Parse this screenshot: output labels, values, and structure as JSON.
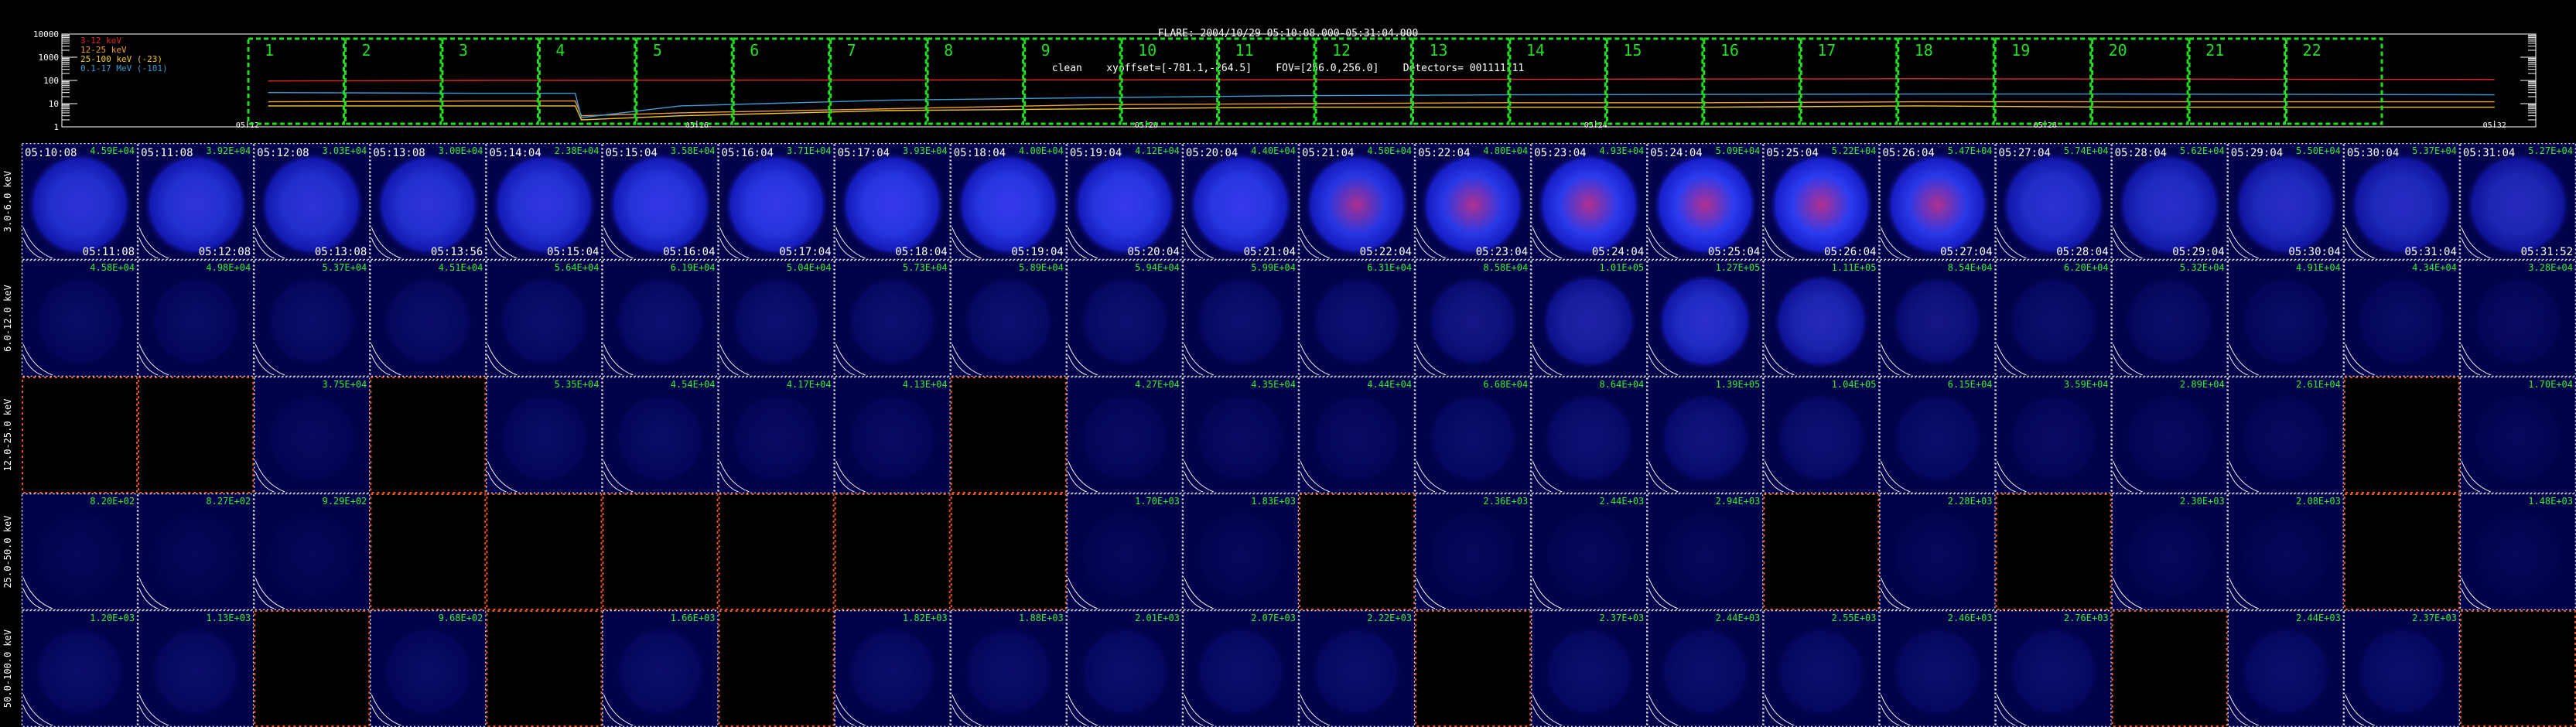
{
  "title": {
    "line1": "FLARE: 2004/10/29 05:10:08.000-05:31:04.000",
    "line2": "clean    xyoffset=[-781.1,-264.5]    FOV=[256.0,256.0]    Detectors= 001111111"
  },
  "colors": {
    "background": "#000000",
    "band_3_12": "#e0282a",
    "band_12_25": "#f0a030",
    "band_25_100": "#f5c820",
    "band_gamma": "#3c9bd6",
    "interval_box": "#22dd22",
    "empty_border": "#ee5522",
    "cell_border": "#e8e8e8",
    "text_green": "#33ee33",
    "disk": "#2a3cf0"
  },
  "chart_data": [
    {
      "type": "line",
      "name_hint": "lightcurve",
      "yscale": "log",
      "yticks": [
        "10000",
        "1000",
        "100",
        "10",
        "1"
      ],
      "ylim": [
        1,
        10000
      ],
      "xlim": [
        0,
        120
      ],
      "x_tick_labels": [
        "05:12",
        "05:16",
        "05:20",
        "05:24",
        "05:28",
        "05:32"
      ],
      "legend": {
        "placement": "top-left",
        "entries": [
          "3-12 keV",
          "12-25 keV",
          "25-100 keV (-23)",
          "0.1-17 MeV (-101)"
        ]
      },
      "intervals": [
        "1",
        "2",
        "3",
        "4",
        "5",
        "6",
        "7",
        "8",
        "9",
        "10",
        "11",
        "12",
        "13",
        "14",
        "15",
        "16",
        "17",
        "18",
        "19",
        "20",
        "21",
        "22"
      ],
      "series": [
        {
          "name": "3-12 keV",
          "color": "#e0282a",
          "x": [
            10,
            20,
            30,
            40,
            50,
            60,
            70,
            80,
            90,
            100,
            110,
            118
          ],
          "y": [
            95,
            100,
            102,
            104,
            106,
            108,
            112,
            115,
            118,
            115,
            112,
            110
          ]
        },
        {
          "name": "12-25 keV",
          "color": "#f0a030",
          "x": [
            10,
            20,
            24.9,
            25.2,
            30,
            40,
            50,
            60,
            70,
            80,
            90,
            100,
            110,
            118
          ],
          "y": [
            12,
            13,
            13,
            3,
            4,
            6,
            9,
            10,
            11,
            11,
            12,
            12,
            12,
            12
          ]
        },
        {
          "name": "25-100 keV (-23)",
          "color": "#f5c820",
          "x": [
            10,
            20,
            24.9,
            25.2,
            30,
            40,
            50,
            60,
            70,
            80,
            90,
            100,
            110,
            118
          ],
          "y": [
            8,
            8,
            8,
            2,
            3,
            5,
            6,
            7,
            7,
            7,
            8,
            7,
            7,
            7
          ]
        },
        {
          "name": "0.1-17 MeV (-101)",
          "color": "#3c9bd6",
          "x": [
            10,
            20,
            24.9,
            25.2,
            30,
            40,
            50,
            60,
            70,
            80,
            90,
            100,
            110,
            118
          ],
          "y": [
            30,
            28,
            28,
            2.5,
            8,
            14,
            18,
            22,
            24,
            25,
            26,
            26,
            25,
            24
          ]
        }
      ]
    },
    {
      "type": "heatmap",
      "name_hint": "image-grid",
      "row_labels": [
        "3.0-6.0 keV",
        "6.0-12.0 keV",
        "12.0-25.0 keV",
        "25.0-50.0 keV",
        "50.0-100.0 keV"
      ],
      "start_times": [
        "05:10:08",
        "05:11:08",
        "05:12:08",
        "05:13:08",
        "05:14:04",
        "05:15:04",
        "05:16:04",
        "05:17:04",
        "05:18:04",
        "05:19:04",
        "05:20:04",
        "05:21:04",
        "05:22:04",
        "05:23:04",
        "05:24:04",
        "05:25:04",
        "05:26:04",
        "05:27:04",
        "05:28:04",
        "05:29:04",
        "05:30:04",
        "05:31:04"
      ],
      "end_times": [
        "05:11:08",
        "05:12:08",
        "05:13:08",
        "05:13:56",
        "05:15:04",
        "05:16:04",
        "05:17:04",
        "05:18:04",
        "05:19:04",
        "05:20:04",
        "05:21:04",
        "05:22:04",
        "05:23:04",
        "05:24:04",
        "05:25:04",
        "05:26:04",
        "05:27:04",
        "05:28:04",
        "05:29:04",
        "05:30:04",
        "05:31:04",
        "05:31:52"
      ],
      "peaks": [
        [
          "4.59E+04",
          "3.92E+04",
          "3.03E+04",
          "3.00E+04",
          "2.38E+04",
          "3.58E+04",
          "3.71E+04",
          "3.93E+04",
          "4.00E+04",
          "4.12E+04",
          "4.40E+04",
          "4.50E+04",
          "4.80E+04",
          "4.93E+04",
          "5.09E+04",
          "5.22E+04",
          "5.47E+04",
          "5.74E+04",
          "5.62E+04",
          "5.50E+04",
          "5.37E+04",
          "5.27E+04"
        ],
        [
          "4.58E+04",
          "4.98E+04",
          "5.37E+04",
          "4.51E+04",
          "5.64E+04",
          "6.19E+04",
          "5.04E+04",
          "5.73E+04",
          "5.89E+04",
          "5.94E+04",
          "5.99E+04",
          "6.31E+04",
          "8.58E+04",
          "1.01E+05",
          "1.27E+05",
          "1.11E+05",
          "8.54E+04",
          "6.20E+04",
          "5.32E+04",
          "4.91E+04",
          "4.34E+04",
          "3.28E+04"
        ],
        [
          "",
          "",
          "3.75E+04",
          "",
          "5.35E+04",
          "4.54E+04",
          "4.17E+04",
          "4.13E+04",
          "",
          "4.27E+04",
          "4.35E+04",
          "4.44E+04",
          "6.68E+04",
          "8.64E+04",
          "1.39E+05",
          "1.04E+05",
          "6.15E+04",
          "3.59E+04",
          "2.89E+04",
          "2.61E+04",
          "",
          "1.70E+04"
        ],
        [
          "8.20E+02",
          "8.27E+02",
          "9.29E+02",
          "",
          "",
          "",
          "",
          "",
          "",
          "1.70E+03",
          "1.83E+03",
          "",
          "2.36E+03",
          "2.44E+03",
          "2.94E+03",
          "",
          "2.28E+03",
          "",
          "2.30E+03",
          "2.08E+03",
          "",
          "1.48E+03"
        ],
        [
          "1.20E+03",
          "1.13E+03",
          "",
          "9.68E+02",
          "",
          "1.66E+03",
          "",
          "1.82E+03",
          "1.88E+03",
          "2.01E+03",
          "2.07E+03",
          "2.22E+03",
          "",
          "2.37E+03",
          "2.44E+03",
          "2.55E+03",
          "2.46E+03",
          "2.76E+03",
          "",
          "2.44E+03",
          "2.37E+03",
          ""
        ]
      ],
      "empty_cells": [
        [
          2,
          0
        ],
        [
          2,
          1
        ],
        [
          2,
          3
        ],
        [
          2,
          8
        ],
        [
          2,
          20
        ],
        [
          3,
          3
        ],
        [
          3,
          4
        ],
        [
          3,
          5
        ],
        [
          3,
          6
        ],
        [
          3,
          7
        ],
        [
          3,
          8
        ],
        [
          3,
          11
        ],
        [
          3,
          15
        ],
        [
          3,
          17
        ],
        [
          3,
          20
        ],
        [
          4,
          2
        ],
        [
          4,
          4
        ],
        [
          4,
          6
        ],
        [
          4,
          12
        ],
        [
          4,
          18
        ],
        [
          4,
          21
        ]
      ],
      "intensity": [
        [
          0.78,
          0.8,
          0.78,
          0.8,
          0.83,
          0.86,
          0.88,
          0.9,
          0.9,
          0.9,
          0.9,
          0.92,
          0.95,
          0.98,
          1.0,
          1.0,
          0.95,
          0.75,
          0.7,
          0.68,
          0.66,
          0.62
        ],
        [
          0.12,
          0.12,
          0.14,
          0.14,
          0.16,
          0.18,
          0.18,
          0.18,
          0.18,
          0.18,
          0.18,
          0.2,
          0.3,
          0.5,
          0.72,
          0.6,
          0.3,
          0.16,
          0.14,
          0.12,
          0.12,
          0.1
        ],
        [
          0.0,
          0.0,
          0.08,
          0.0,
          0.12,
          0.12,
          0.1,
          0.1,
          0.0,
          0.1,
          0.1,
          0.1,
          0.15,
          0.2,
          0.25,
          0.2,
          0.15,
          0.1,
          0.08,
          0.08,
          0.0,
          0.06
        ],
        [
          0.05,
          0.05,
          0.05,
          0.0,
          0.0,
          0.0,
          0.0,
          0.0,
          0.0,
          0.06,
          0.06,
          0.0,
          0.06,
          0.06,
          0.06,
          0.0,
          0.06,
          0.0,
          0.06,
          0.05,
          0.0,
          0.05
        ],
        [
          0.14,
          0.14,
          0.0,
          0.12,
          0.0,
          0.14,
          0.0,
          0.14,
          0.14,
          0.16,
          0.16,
          0.16,
          0.0,
          0.16,
          0.16,
          0.16,
          0.16,
          0.16,
          0.0,
          0.16,
          0.16,
          0.0
        ]
      ]
    }
  ]
}
